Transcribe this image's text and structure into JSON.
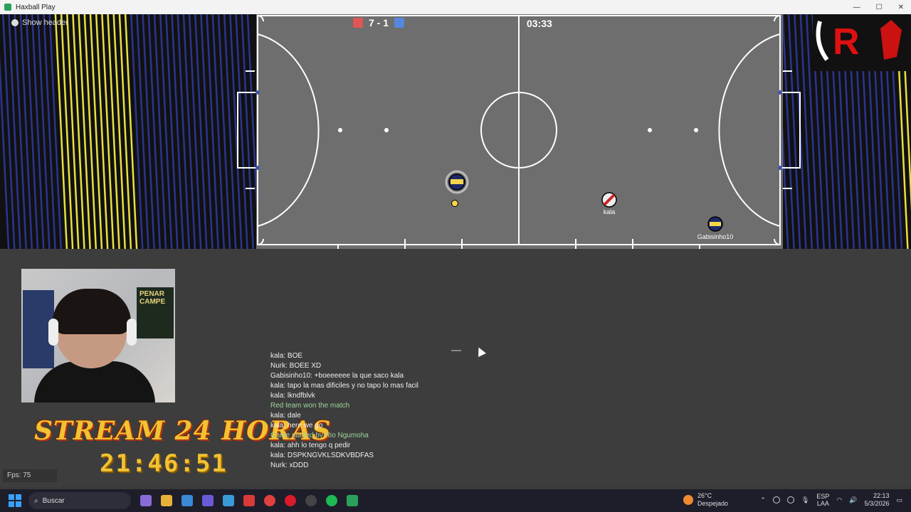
{
  "window": {
    "title": "Haxball Play"
  },
  "hud": {
    "show_header": "Show header",
    "score": "7 - 1",
    "time": "03:33",
    "red_color": "#e05555",
    "blue_color": "#5588dd"
  },
  "players": [
    {
      "name": "",
      "team": "blue"
    },
    {
      "name": "kala",
      "team": "red"
    },
    {
      "name": "Gabisinho10",
      "team": "blue"
    }
  ],
  "overlay": {
    "stream_title": "STREAM 24 HORAS",
    "stream_clock": "21:46:51",
    "poster_text": "PENAR CAMPE"
  },
  "fps": "Fps: 75",
  "chat": [
    {
      "text": "kala: BOE",
      "sys": false
    },
    {
      "text": "Nurk: BOEE XD",
      "sys": false
    },
    {
      "text": "Gabisinho10: +boeeeeee la que saco kala",
      "sys": false
    },
    {
      "text": "kala: tapo la mas dificiles y no tapo lo mas facil",
      "sys": false
    },
    {
      "text": "kala: lkndfblvk",
      "sys": false
    },
    {
      "text": "Red team won the match",
      "sys": true
    },
    {
      "text": "kala: dale",
      "sys": false
    },
    {
      "text": "kala: here we go",
      "sys": false
    },
    {
      "text": "Game started by Rio Ngumoha",
      "sys": true
    },
    {
      "text": "kala: ahh lo tengo q pedir",
      "sys": false
    },
    {
      "text": "kala: DSPKNGVKLSDKVBDFAS",
      "sys": false
    },
    {
      "text": "Nurk: xDDD",
      "sys": false
    }
  ],
  "taskbar": {
    "search_placeholder": "Buscar",
    "weather_temp": "26°C",
    "weather_desc": "Despejado",
    "lang_top": "ESP",
    "lang_bottom": "LAA",
    "clock_time": "22:13",
    "clock_date": "5/3/2026"
  }
}
